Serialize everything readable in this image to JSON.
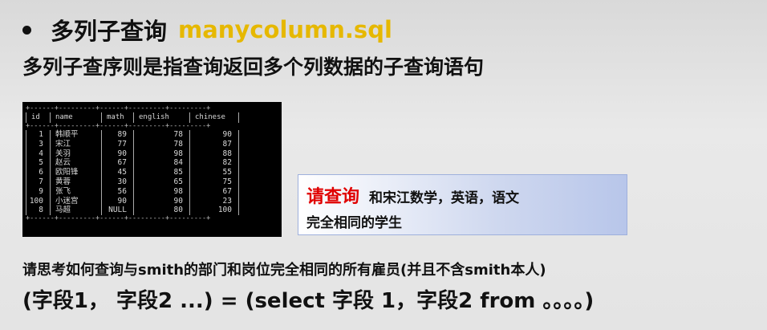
{
  "heading": {
    "prefix": "多列子查询",
    "filename": "manycolumn.sql"
  },
  "subtitle": "多列子查序则是指查询返回多个列数据的子查询语句",
  "terminal": {
    "border_top": "+------+---------+------+---------+---------+",
    "columns": [
      "id",
      "name",
      "math",
      "english",
      "chinese"
    ],
    "border_mid": "+------+---------+------+---------+---------+",
    "rows": [
      [
        "1",
        "韩顺平",
        "89",
        "78",
        "90"
      ],
      [
        "3",
        "宋江",
        "77",
        "78",
        "87"
      ],
      [
        "4",
        "关羽",
        "90",
        "98",
        "88"
      ],
      [
        "5",
        "赵云",
        "67",
        "84",
        "82"
      ],
      [
        "6",
        "欧阳锋",
        "45",
        "85",
        "55"
      ],
      [
        "7",
        "黄蓉",
        "30",
        "65",
        "75"
      ],
      [
        "9",
        "张飞",
        "56",
        "98",
        "67"
      ],
      [
        "100",
        "小迷宫",
        "90",
        "90",
        "23"
      ],
      [
        "8",
        "马超",
        "NULL",
        "80",
        "100"
      ]
    ],
    "border_bottom": "+------+---------+------+---------+---------+"
  },
  "callout": {
    "highlight": "请查询",
    "line1": "和宋江数学，英语，语文",
    "line2": "完全相同的学生"
  },
  "hint": "请思考如何查询与smith的部门和岗位完全相同的所有雇员(并且不含smith本人)",
  "syntax": "(字段1，  字段2 ...) = (select 字段 1，字段2 from 。。。。)"
}
